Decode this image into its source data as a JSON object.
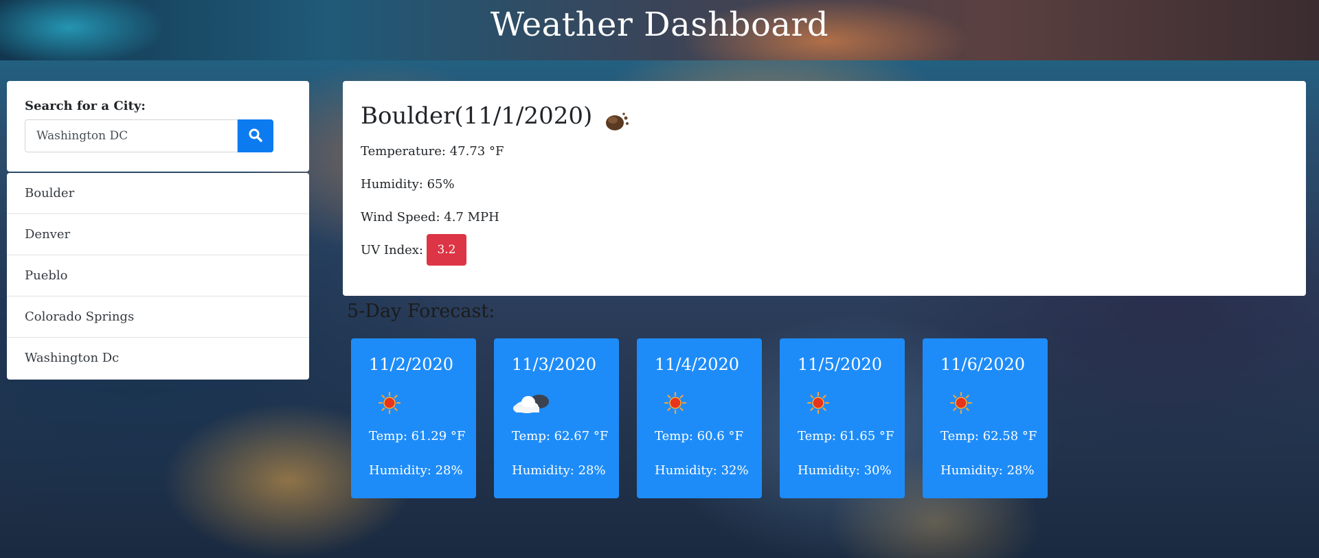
{
  "header": {
    "title": "Weather Dashboard"
  },
  "search": {
    "label": "Search for a City:",
    "value": "Washington DC",
    "button_icon": "search-icon"
  },
  "history": [
    {
      "label": "Boulder"
    },
    {
      "label": "Denver"
    },
    {
      "label": "Pueblo"
    },
    {
      "label": "Colorado Springs"
    },
    {
      "label": "Washington Dc"
    }
  ],
  "current": {
    "title": "Boulder(11/1/2020)",
    "icon": "night-cloud-icon",
    "temperature": "Temperature: 47.73 °F",
    "humidity": "Humidity: 65%",
    "wind": "Wind Speed: 4.7 MPH",
    "uv_label": "UV Index:",
    "uv_value": "3.2",
    "uv_color": "#dc3545"
  },
  "forecast": {
    "title": "5-Day Forecast:",
    "days": [
      {
        "date": "11/2/2020",
        "icon": "sun-icon",
        "temp": "Temp: 61.29 °F",
        "humidity": "Humidity: 28%"
      },
      {
        "date": "11/3/2020",
        "icon": "cloud-icon",
        "temp": "Temp: 62.67 °F",
        "humidity": "Humidity: 28%"
      },
      {
        "date": "11/4/2020",
        "icon": "sun-icon",
        "temp": "Temp: 60.6 °F",
        "humidity": "Humidity: 32%"
      },
      {
        "date": "11/5/2020",
        "icon": "sun-icon",
        "temp": "Temp: 61.65 °F",
        "humidity": "Humidity: 30%"
      },
      {
        "date": "11/6/2020",
        "icon": "sun-icon",
        "temp": "Temp: 62.58 °F",
        "humidity": "Humidity: 28%"
      }
    ],
    "card_color": "#1e8cf8"
  },
  "colors": {
    "accent": "#0d7bf0",
    "uv_high": "#dc3545"
  }
}
